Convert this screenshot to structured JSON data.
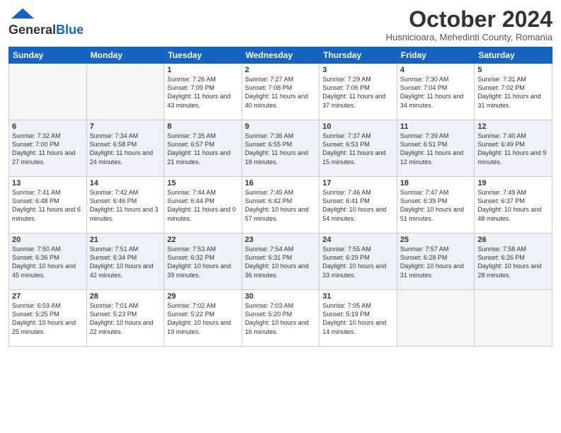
{
  "header": {
    "logo_general": "General",
    "logo_blue": "Blue",
    "month_title": "October 2024",
    "location": "Husnicioara, Mehedinti County, Romania"
  },
  "days_of_week": [
    "Sunday",
    "Monday",
    "Tuesday",
    "Wednesday",
    "Thursday",
    "Friday",
    "Saturday"
  ],
  "rows": [
    [
      {
        "day": "",
        "empty": true
      },
      {
        "day": "",
        "empty": true
      },
      {
        "day": "1",
        "sunrise": "Sunrise: 7:26 AM",
        "sunset": "Sunset: 7:09 PM",
        "daylight": "Daylight: 11 hours and 43 minutes."
      },
      {
        "day": "2",
        "sunrise": "Sunrise: 7:27 AM",
        "sunset": "Sunset: 7:08 PM",
        "daylight": "Daylight: 11 hours and 40 minutes."
      },
      {
        "day": "3",
        "sunrise": "Sunrise: 7:29 AM",
        "sunset": "Sunset: 7:06 PM",
        "daylight": "Daylight: 11 hours and 37 minutes."
      },
      {
        "day": "4",
        "sunrise": "Sunrise: 7:30 AM",
        "sunset": "Sunset: 7:04 PM",
        "daylight": "Daylight: 11 hours and 34 minutes."
      },
      {
        "day": "5",
        "sunrise": "Sunrise: 7:31 AM",
        "sunset": "Sunset: 7:02 PM",
        "daylight": "Daylight: 11 hours and 31 minutes."
      }
    ],
    [
      {
        "day": "6",
        "sunrise": "Sunrise: 7:32 AM",
        "sunset": "Sunset: 7:00 PM",
        "daylight": "Daylight: 11 hours and 27 minutes."
      },
      {
        "day": "7",
        "sunrise": "Sunrise: 7:34 AM",
        "sunset": "Sunset: 6:58 PM",
        "daylight": "Daylight: 11 hours and 24 minutes."
      },
      {
        "day": "8",
        "sunrise": "Sunrise: 7:35 AM",
        "sunset": "Sunset: 6:57 PM",
        "daylight": "Daylight: 11 hours and 21 minutes."
      },
      {
        "day": "9",
        "sunrise": "Sunrise: 7:36 AM",
        "sunset": "Sunset: 6:55 PM",
        "daylight": "Daylight: 11 hours and 18 minutes."
      },
      {
        "day": "10",
        "sunrise": "Sunrise: 7:37 AM",
        "sunset": "Sunset: 6:53 PM",
        "daylight": "Daylight: 11 hours and 15 minutes."
      },
      {
        "day": "11",
        "sunrise": "Sunrise: 7:39 AM",
        "sunset": "Sunset: 6:51 PM",
        "daylight": "Daylight: 11 hours and 12 minutes."
      },
      {
        "day": "12",
        "sunrise": "Sunrise: 7:40 AM",
        "sunset": "Sunset: 6:49 PM",
        "daylight": "Daylight: 11 hours and 9 minutes."
      }
    ],
    [
      {
        "day": "13",
        "sunrise": "Sunrise: 7:41 AM",
        "sunset": "Sunset: 6:48 PM",
        "daylight": "Daylight: 11 hours and 6 minutes."
      },
      {
        "day": "14",
        "sunrise": "Sunrise: 7:42 AM",
        "sunset": "Sunset: 6:46 PM",
        "daylight": "Daylight: 11 hours and 3 minutes."
      },
      {
        "day": "15",
        "sunrise": "Sunrise: 7:44 AM",
        "sunset": "Sunset: 6:44 PM",
        "daylight": "Daylight: 11 hours and 0 minutes."
      },
      {
        "day": "16",
        "sunrise": "Sunrise: 7:45 AM",
        "sunset": "Sunset: 6:42 PM",
        "daylight": "Daylight: 10 hours and 57 minutes."
      },
      {
        "day": "17",
        "sunrise": "Sunrise: 7:46 AM",
        "sunset": "Sunset: 6:41 PM",
        "daylight": "Daylight: 10 hours and 54 minutes."
      },
      {
        "day": "18",
        "sunrise": "Sunrise: 7:47 AM",
        "sunset": "Sunset: 6:39 PM",
        "daylight": "Daylight: 10 hours and 51 minutes."
      },
      {
        "day": "19",
        "sunrise": "Sunrise: 7:49 AM",
        "sunset": "Sunset: 6:37 PM",
        "daylight": "Daylight: 10 hours and 48 minutes."
      }
    ],
    [
      {
        "day": "20",
        "sunrise": "Sunrise: 7:50 AM",
        "sunset": "Sunset: 6:36 PM",
        "daylight": "Daylight: 10 hours and 45 minutes."
      },
      {
        "day": "21",
        "sunrise": "Sunrise: 7:51 AM",
        "sunset": "Sunset: 6:34 PM",
        "daylight": "Daylight: 10 hours and 42 minutes."
      },
      {
        "day": "22",
        "sunrise": "Sunrise: 7:53 AM",
        "sunset": "Sunset: 6:32 PM",
        "daylight": "Daylight: 10 hours and 39 minutes."
      },
      {
        "day": "23",
        "sunrise": "Sunrise: 7:54 AM",
        "sunset": "Sunset: 6:31 PM",
        "daylight": "Daylight: 10 hours and 36 minutes."
      },
      {
        "day": "24",
        "sunrise": "Sunrise: 7:55 AM",
        "sunset": "Sunset: 6:29 PM",
        "daylight": "Daylight: 10 hours and 33 minutes."
      },
      {
        "day": "25",
        "sunrise": "Sunrise: 7:57 AM",
        "sunset": "Sunset: 6:28 PM",
        "daylight": "Daylight: 10 hours and 31 minutes."
      },
      {
        "day": "26",
        "sunrise": "Sunrise: 7:58 AM",
        "sunset": "Sunset: 6:26 PM",
        "daylight": "Daylight: 10 hours and 28 minutes."
      }
    ],
    [
      {
        "day": "27",
        "sunrise": "Sunrise: 6:59 AM",
        "sunset": "Sunset: 5:25 PM",
        "daylight": "Daylight: 10 hours and 25 minutes."
      },
      {
        "day": "28",
        "sunrise": "Sunrise: 7:01 AM",
        "sunset": "Sunset: 5:23 PM",
        "daylight": "Daylight: 10 hours and 22 minutes."
      },
      {
        "day": "29",
        "sunrise": "Sunrise: 7:02 AM",
        "sunset": "Sunset: 5:22 PM",
        "daylight": "Daylight: 10 hours and 19 minutes."
      },
      {
        "day": "30",
        "sunrise": "Sunrise: 7:03 AM",
        "sunset": "Sunset: 5:20 PM",
        "daylight": "Daylight: 10 hours and 16 minutes."
      },
      {
        "day": "31",
        "sunrise": "Sunrise: 7:05 AM",
        "sunset": "Sunset: 5:19 PM",
        "daylight": "Daylight: 10 hours and 14 minutes."
      },
      {
        "day": "",
        "empty": true
      },
      {
        "day": "",
        "empty": true
      }
    ]
  ]
}
